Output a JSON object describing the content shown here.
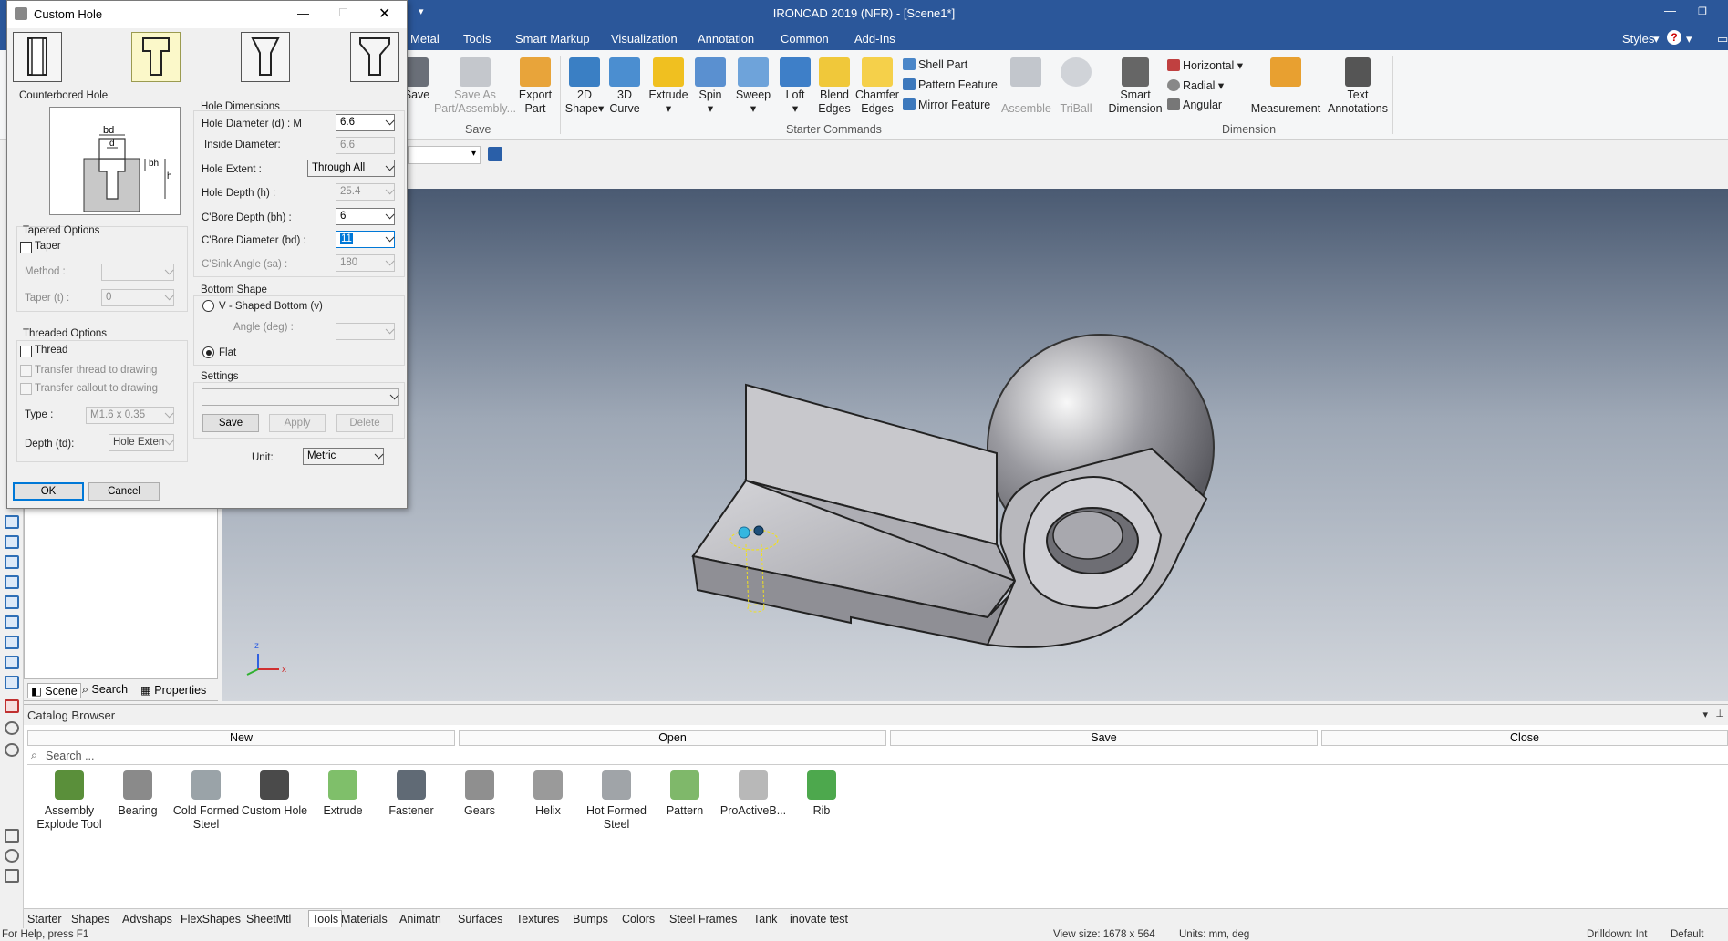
{
  "app": {
    "title": "IRONCAD 2019 (NFR) - [Scene1*]",
    "menus": [
      "Metal",
      "Tools",
      "Smart Markup",
      "Visualization",
      "Annotation",
      "Common",
      "Add-Ins"
    ],
    "styles_label": "Styles",
    "accent_color": "#2b579a"
  },
  "ribbon": {
    "save_group": {
      "save": "Save",
      "save_as_line1": "Save As",
      "save_as_line2": "Part/Assembly...",
      "export_line1": "Export",
      "export_line2": "Part",
      "label": "Save"
    },
    "starter": {
      "label": "Starter Commands",
      "buttons": [
        {
          "l1": "2D",
          "l2": "Shape"
        },
        {
          "l1": "3D",
          "l2": "Curve"
        },
        {
          "l1": "Extrude",
          "l2": ""
        },
        {
          "l1": "Spin",
          "l2": ""
        },
        {
          "l1": "Sweep",
          "l2": ""
        },
        {
          "l1": "Loft",
          "l2": ""
        },
        {
          "l1": "Blend",
          "l2": "Edges"
        },
        {
          "l1": "Chamfer",
          "l2": "Edges"
        }
      ],
      "small": [
        "Shell Part",
        "Pattern Feature",
        "Mirror Feature"
      ],
      "assemble": "Assemble",
      "triball": "TriBall"
    },
    "dimension": {
      "label": "Dimension",
      "smart_l1": "Smart",
      "smart_l2": "Dimension",
      "small": [
        "Horizontal",
        "Radial",
        "Angular"
      ],
      "measurement": "Measurement",
      "text_l1": "Text",
      "text_l2": "Annotations"
    }
  },
  "scene_tabs": [
    "Scene",
    "Search",
    "Properties"
  ],
  "catalog": {
    "title": "Catalog Browser",
    "buttons": [
      "New",
      "Open",
      "Save",
      "Close"
    ],
    "search_placeholder": "Search ...",
    "items": [
      {
        "l1": "Assembly",
        "l2": "Explode Tool",
        "color": "#5a8f3a"
      },
      {
        "l1": "Bearing",
        "l2": "",
        "color": "#8a8a8a"
      },
      {
        "l1": "Cold Formed",
        "l2": "Steel",
        "color": "#9aa3a8"
      },
      {
        "l1": "Custom Hole",
        "l2": "",
        "color": "#4a4a4a"
      },
      {
        "l1": "Extrude",
        "l2": "",
        "color": "#7fbf6a"
      },
      {
        "l1": "Fastener",
        "l2": "",
        "color": "#606a75"
      },
      {
        "l1": "Gears",
        "l2": "",
        "color": "#8f8f8f"
      },
      {
        "l1": "Helix",
        "l2": "",
        "color": "#9a9a9a"
      },
      {
        "l1": "Hot Formed",
        "l2": "Steel",
        "color": "#a0a4a8"
      },
      {
        "l1": "Pattern",
        "l2": "",
        "color": "#7fb86a"
      },
      {
        "l1": "ProActiveB...",
        "l2": "",
        "color": "#b8b8b8"
      },
      {
        "l1": "Rib",
        "l2": "",
        "color": "#4da84d"
      }
    ]
  },
  "bottom_tabs": [
    "Starter",
    "Shapes",
    "Advshaps",
    "FlexShapes",
    "SheetMtl",
    "Tools",
    "Materials",
    "Animatn",
    "Surfaces",
    "Textures",
    "Bumps",
    "Colors",
    "Steel Frames",
    "Tank",
    "inovate test"
  ],
  "active_bottom_tab": "Tools",
  "status": {
    "help": "For Help, press F1",
    "view_size": "View size: 1678 x 564",
    "units": "Units: mm, deg",
    "drilldown": "Drilldown: Int",
    "default": "Default"
  },
  "dialog": {
    "title": "Custom Hole",
    "hole_type_label": "Counterbored Hole",
    "diagram_labels": {
      "bd": "bd",
      "d": "d",
      "bh": "bh",
      "h": "h"
    },
    "hole_dimensions": {
      "group": "Hole Dimensions",
      "hole_diameter_label": "Hole Diameter (d) : M",
      "hole_diameter_value": "6.6",
      "inside_diameter_label": "Inside Diameter:",
      "inside_diameter_value": "6.6",
      "hole_extent_label": "Hole Extent :",
      "hole_extent_value": "Through All",
      "hole_depth_label": "Hole Depth (h) :",
      "hole_depth_value": "25.4",
      "cbore_depth_label": "C'Bore Depth (bh) :",
      "cbore_depth_value": "6",
      "cbore_diameter_label": "C'Bore Diameter (bd) :",
      "cbore_diameter_value": "11",
      "csink_angle_label": "C'Sink Angle (sa) :",
      "csink_angle_value": "180"
    },
    "tapered": {
      "group": "Tapered Options",
      "taper": "Taper",
      "method": "Method :",
      "taper_t": "Taper (t) :",
      "taper_value": "0"
    },
    "threaded": {
      "group": "Threaded Options",
      "thread": "Thread",
      "transfer_thread": "Transfer thread to drawing",
      "transfer_callout": "Transfer callout to drawing",
      "type": "Type :",
      "type_value": "M1.6 x 0.35",
      "depth": "Depth (td):",
      "depth_value": "Hole Exten"
    },
    "bottom_shape": {
      "group": "Bottom Shape",
      "v_shaped": "V - Shaped Bottom (v)",
      "angle": "Angle (deg) :",
      "flat": "Flat"
    },
    "settings": {
      "group": "Settings",
      "save": "Save",
      "apply": "Apply",
      "delete": "Delete"
    },
    "unit_label": "Unit:",
    "unit_value": "Metric",
    "ok": "OK",
    "cancel": "Cancel"
  }
}
